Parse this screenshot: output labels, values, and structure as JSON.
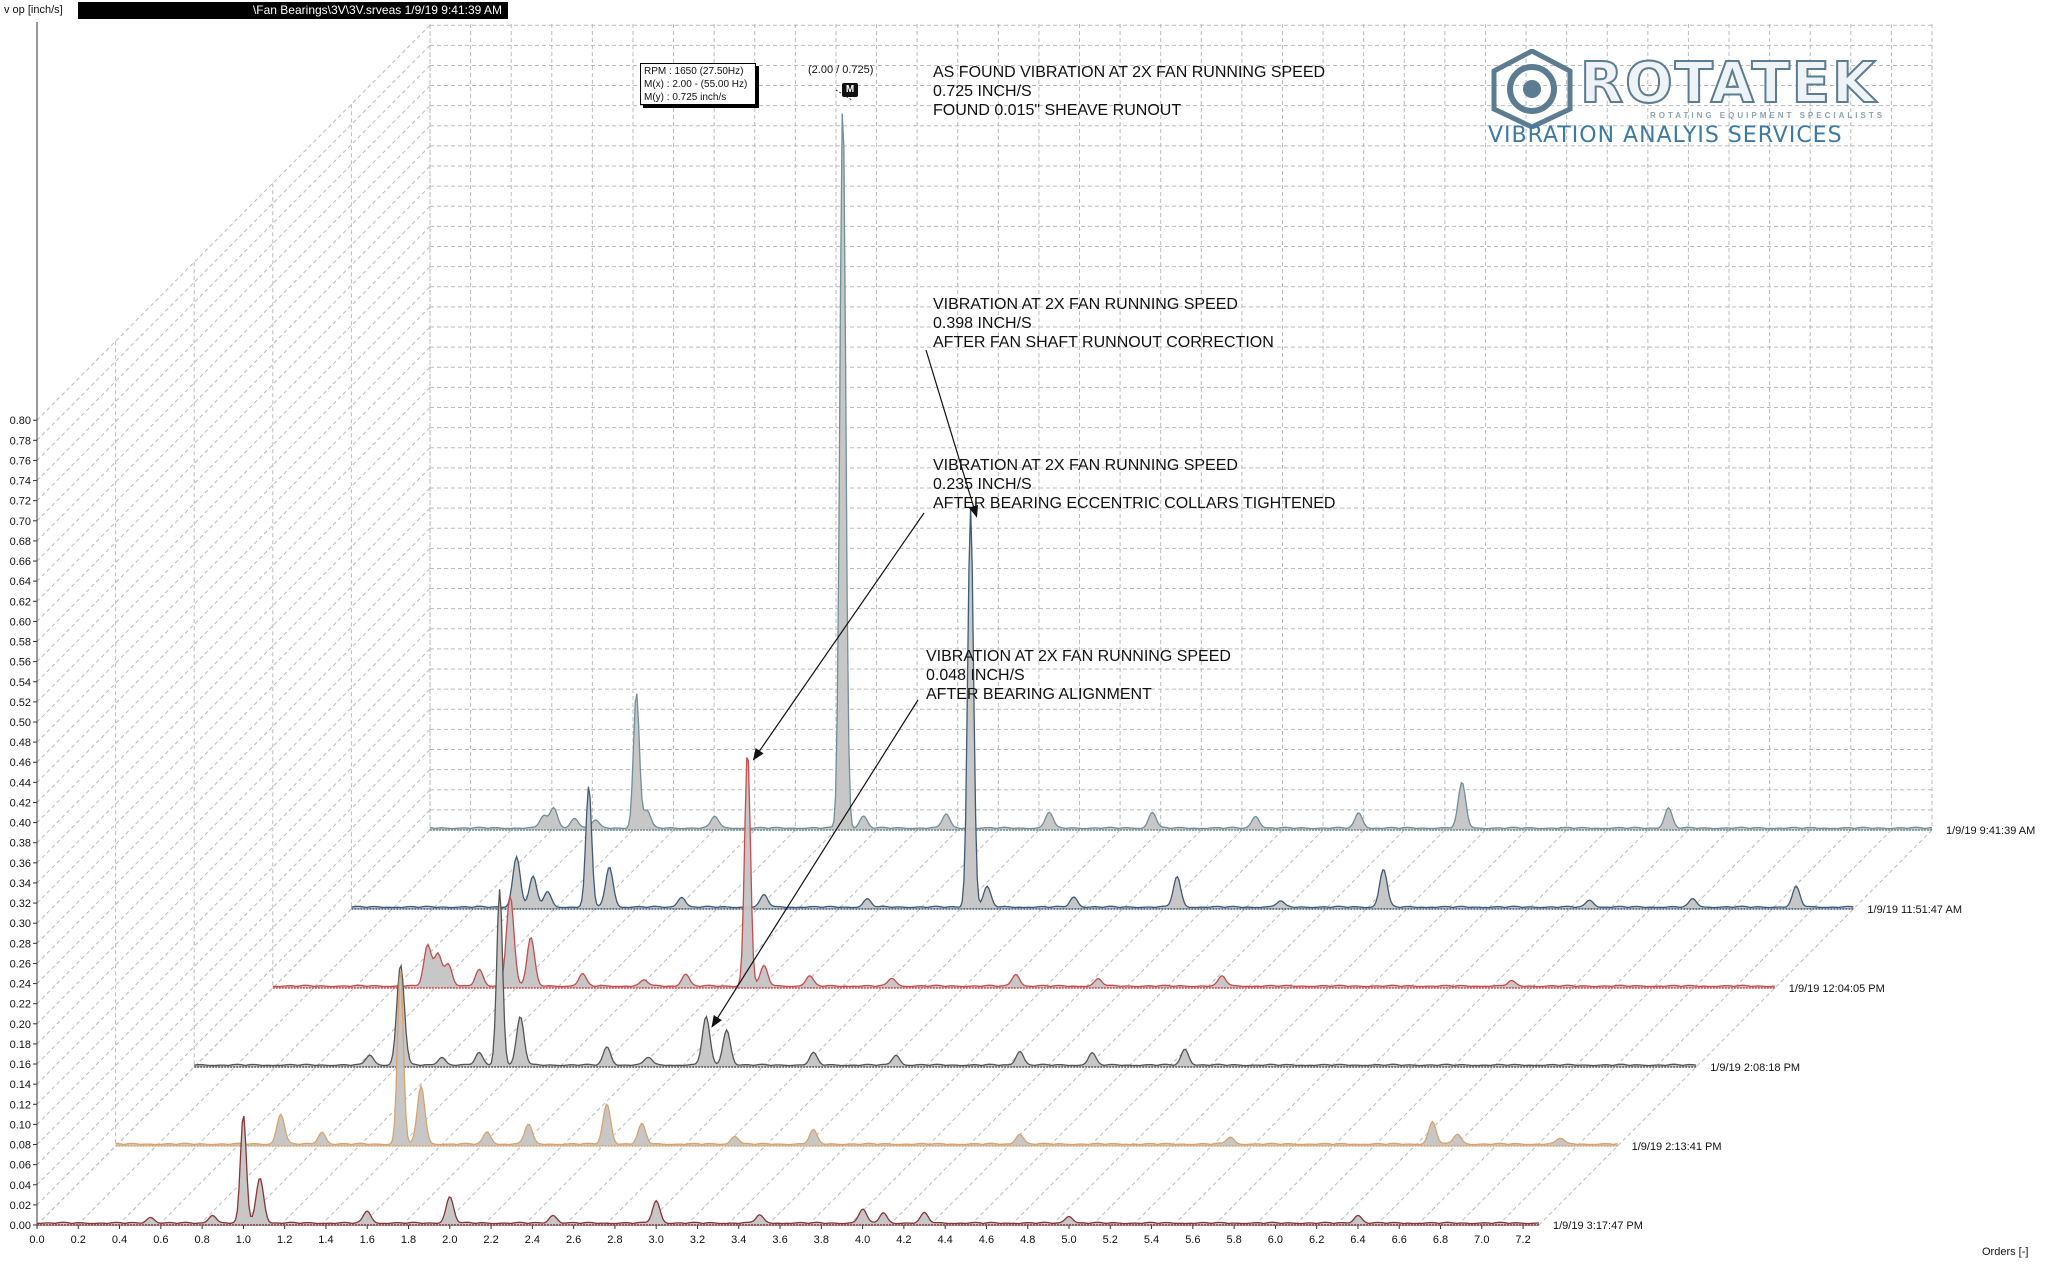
{
  "header": {
    "y_unit": "v op [inch/s]",
    "file_label": "\\Fan Bearings\\3V\\3V.srveas  1/9/19 9:41:39 AM",
    "x_unit": "Orders [-]"
  },
  "tooltip": {
    "line1": "RPM : 1650 (27.50Hz)",
    "line2": "M(x) : 2.00 - (55.00 Hz)",
    "line3": "M(y) : 0.725 inch/s",
    "coord": "(2.00 / 0.725)",
    "marker": "M"
  },
  "logo": {
    "name": "ROTATEK",
    "tagline": "ROTATING EQUIPMENT SPECIALISTS",
    "subtitle": "VIBRATION ANALYIS SERVICES"
  },
  "annotations": [
    {
      "lines": [
        "AS FOUND VIBRATION AT 2X FAN RUNNING SPEED",
        "0.725 INCH/S",
        "FOUND 0.015\" SHEAVE RUNOUT"
      ]
    },
    {
      "lines": [
        "VIBRATION AT 2X FAN RUNNING SPEED",
        "0.398 INCH/S",
        "AFTER FAN SHAFT RUNNOUT CORRECTION"
      ]
    },
    {
      "lines": [
        "VIBRATION AT 2X FAN RUNNING SPEED",
        "0.235 INCH/S",
        "AFTER BEARING ECCENTRIC COLLARS TIGHTENED"
      ]
    },
    {
      "lines": [
        "VIBRATION AT 2X FAN RUNNING SPEED",
        "0.048 INCH/S",
        "AFTER BEARING ALIGNMENT"
      ]
    }
  ],
  "colors": {
    "background": "#ffffff",
    "grid": "#bbbbbb",
    "fill": "#c4c4c4",
    "axis": "#333333",
    "arrow": "#111111"
  },
  "chart_data": {
    "type": "area",
    "style": "waterfall",
    "xlabel": "Orders [-]",
    "ylabel": "v op [inch/s]",
    "xlim": [
      0.0,
      7.3
    ],
    "ylim": [
      0.0,
      0.8
    ],
    "x_ticks": [
      "0.0",
      "0.2",
      "0.4",
      "0.6",
      "0.8",
      "1.0",
      "1.2",
      "1.4",
      "1.6",
      "1.8",
      "2.0",
      "2.2",
      "2.4",
      "2.6",
      "2.8",
      "3.0",
      "3.2",
      "3.4",
      "3.6",
      "3.8",
      "4.0",
      "4.2",
      "4.4",
      "4.6",
      "4.8",
      "5.0",
      "5.2",
      "5.4",
      "5.6",
      "5.8",
      "6.0",
      "6.2",
      "6.4",
      "6.6",
      "6.8",
      "7.0",
      "7.2"
    ],
    "y_ticks": [
      "0.00",
      "0.02",
      "0.04",
      "0.06",
      "0.08",
      "0.10",
      "0.12",
      "0.14",
      "0.16",
      "0.18",
      "0.20",
      "0.22",
      "0.24",
      "0.26",
      "0.28",
      "0.30",
      "0.32",
      "0.34",
      "0.36",
      "0.38",
      "0.40",
      "0.42",
      "0.44",
      "0.46",
      "0.48",
      "0.50",
      "0.52",
      "0.54",
      "0.56",
      "0.58",
      "0.60",
      "0.62",
      "0.64",
      "0.66",
      "0.68",
      "0.70",
      "0.72",
      "0.74",
      "0.76",
      "0.78",
      "0.80"
    ],
    "grid": true,
    "series": [
      {
        "name": "1/9/19 3:17:47 PM",
        "color": "#8a3434",
        "peaks": [
          [
            0.55,
            0.006
          ],
          [
            0.85,
            0.008
          ],
          [
            1.0,
            0.108
          ],
          [
            1.08,
            0.045
          ],
          [
            1.6,
            0.012
          ],
          [
            2.0,
            0.026
          ],
          [
            2.5,
            0.008
          ],
          [
            3.0,
            0.022
          ],
          [
            3.5,
            0.008
          ],
          [
            4.0,
            0.014
          ],
          [
            4.1,
            0.01
          ],
          [
            4.3,
            0.01
          ],
          [
            5.0,
            0.007
          ],
          [
            6.4,
            0.008
          ]
        ]
      },
      {
        "name": "1/9/19 2:13:41 PM",
        "color": "#d9a36b",
        "peaks": [
          [
            0.8,
            0.03
          ],
          [
            1.0,
            0.012
          ],
          [
            1.38,
            0.175
          ],
          [
            1.48,
            0.058
          ],
          [
            1.8,
            0.012
          ],
          [
            2.0,
            0.02
          ],
          [
            2.38,
            0.04
          ],
          [
            2.55,
            0.02
          ],
          [
            3.0,
            0.008
          ],
          [
            3.38,
            0.014
          ],
          [
            4.38,
            0.01
          ],
          [
            5.4,
            0.007
          ],
          [
            6.38,
            0.022
          ],
          [
            6.5,
            0.01
          ],
          [
            7.0,
            0.006
          ]
        ]
      },
      {
        "name": "1/9/19 2:08:18 PM",
        "color": "#555555",
        "peaks": [
          [
            0.85,
            0.01
          ],
          [
            1.0,
            0.1
          ],
          [
            1.2,
            0.008
          ],
          [
            1.38,
            0.012
          ],
          [
            1.48,
            0.175
          ],
          [
            1.58,
            0.048
          ],
          [
            2.0,
            0.018
          ],
          [
            2.2,
            0.008
          ],
          [
            2.48,
            0.048
          ],
          [
            2.58,
            0.035
          ],
          [
            3.0,
            0.012
          ],
          [
            3.4,
            0.01
          ],
          [
            4.0,
            0.014
          ],
          [
            4.35,
            0.012
          ],
          [
            4.8,
            0.016
          ]
        ]
      },
      {
        "name": "1/9/19 12:04:05 PM",
        "color": "#c94a4a",
        "peaks": [
          [
            0.75,
            0.04
          ],
          [
            0.8,
            0.032
          ],
          [
            0.85,
            0.022
          ],
          [
            1.0,
            0.016
          ],
          [
            1.15,
            0.09
          ],
          [
            1.25,
            0.048
          ],
          [
            1.5,
            0.012
          ],
          [
            1.8,
            0.006
          ],
          [
            2.0,
            0.012
          ],
          [
            2.3,
            0.235
          ],
          [
            2.38,
            0.02
          ],
          [
            2.6,
            0.01
          ],
          [
            3.0,
            0.008
          ],
          [
            3.6,
            0.012
          ],
          [
            4.0,
            0.007
          ],
          [
            4.6,
            0.01
          ],
          [
            6.0,
            0.005
          ]
        ]
      },
      {
        "name": "1/9/19 11:51:47 AM",
        "color": "#3d5a78",
        "peaks": [
          [
            0.8,
            0.05
          ],
          [
            0.88,
            0.03
          ],
          [
            0.95,
            0.015
          ],
          [
            1.15,
            0.12
          ],
          [
            1.25,
            0.04
          ],
          [
            1.6,
            0.01
          ],
          [
            2.0,
            0.012
          ],
          [
            2.5,
            0.008
          ],
          [
            3.0,
            0.398
          ],
          [
            3.08,
            0.02
          ],
          [
            3.5,
            0.01
          ],
          [
            4.0,
            0.03
          ],
          [
            4.5,
            0.006
          ],
          [
            5.0,
            0.038
          ],
          [
            6.0,
            0.007
          ],
          [
            6.5,
            0.008
          ],
          [
            7.0,
            0.02
          ],
          [
            7.5,
            0.012
          ]
        ]
      },
      {
        "name": "1/9/19 9:41:39 AM",
        "color": "#6f8f99",
        "peaks": [
          [
            0.55,
            0.012
          ],
          [
            0.6,
            0.02
          ],
          [
            0.7,
            0.01
          ],
          [
            0.8,
            0.008
          ],
          [
            1.0,
            0.135
          ],
          [
            1.05,
            0.018
          ],
          [
            1.38,
            0.012
          ],
          [
            2.0,
            0.725
          ],
          [
            2.1,
            0.012
          ],
          [
            2.5,
            0.014
          ],
          [
            3.0,
            0.016
          ],
          [
            3.5,
            0.016
          ],
          [
            4.0,
            0.012
          ],
          [
            4.5,
            0.015
          ],
          [
            5.0,
            0.045
          ],
          [
            6.0,
            0.02
          ]
        ]
      }
    ],
    "legend": "labels at right end of each trace"
  }
}
